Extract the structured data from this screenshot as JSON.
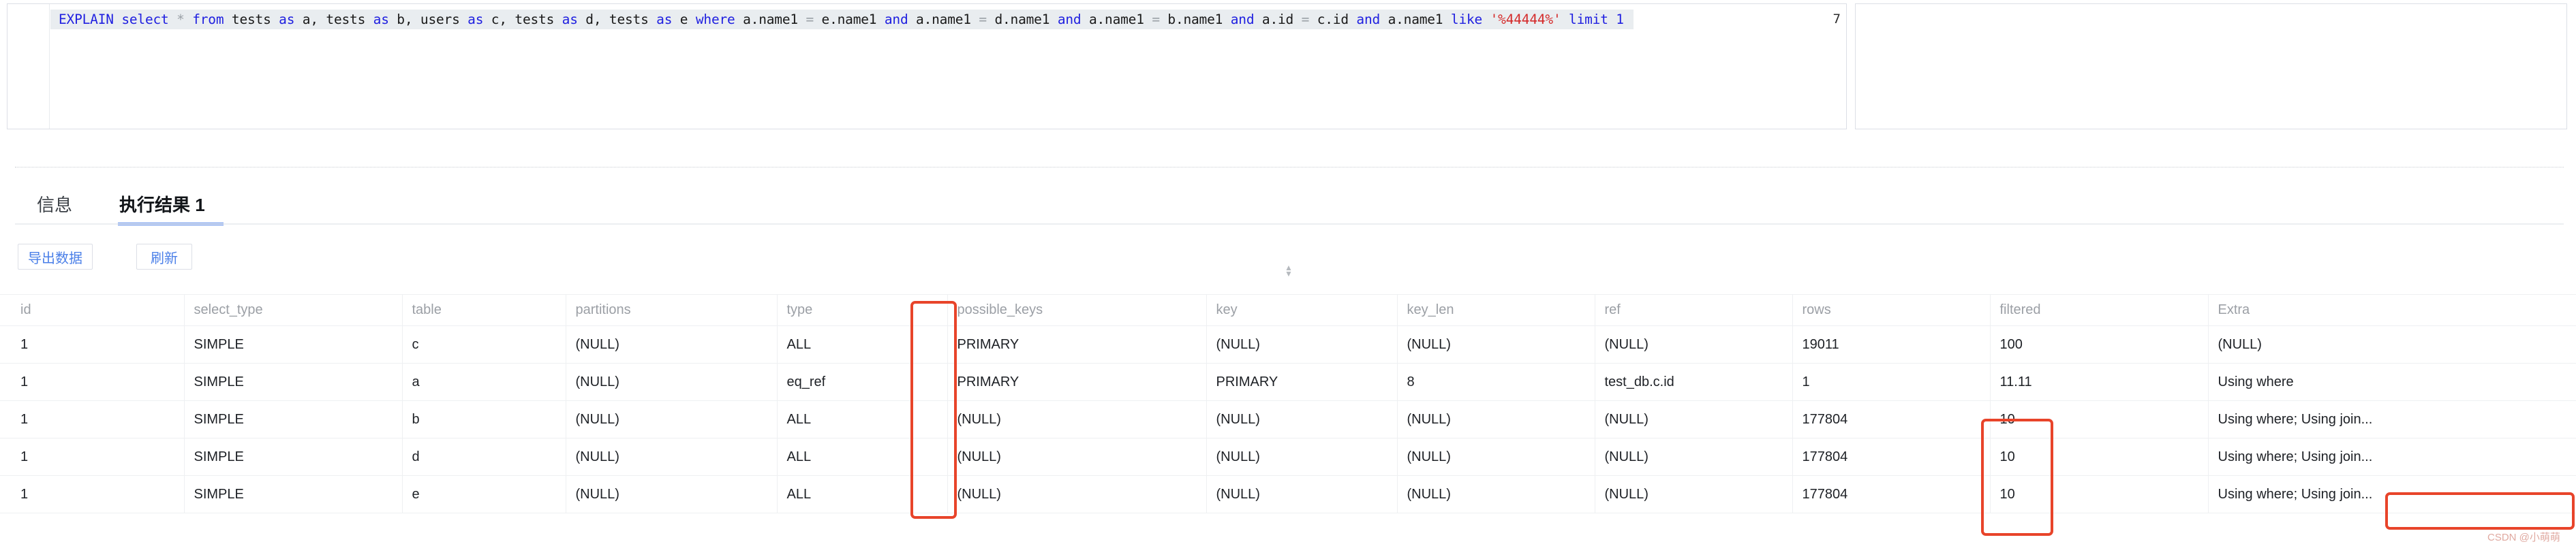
{
  "editor": {
    "line_number": "7",
    "sql_tokens": [
      {
        "t": "EXPLAIN",
        "c": "kw"
      },
      {
        "t": " ",
        "c": "plain"
      },
      {
        "t": "select",
        "c": "kw"
      },
      {
        "t": " ",
        "c": "plain"
      },
      {
        "t": "*",
        "c": "op-star"
      },
      {
        "t": " ",
        "c": "plain"
      },
      {
        "t": "from",
        "c": "kw"
      },
      {
        "t": " tests ",
        "c": "plain"
      },
      {
        "t": "as",
        "c": "kw"
      },
      {
        "t": " a, tests ",
        "c": "plain"
      },
      {
        "t": "as",
        "c": "kw"
      },
      {
        "t": " b, users ",
        "c": "plain"
      },
      {
        "t": "as",
        "c": "kw"
      },
      {
        "t": " c, tests ",
        "c": "plain"
      },
      {
        "t": "as",
        "c": "kw"
      },
      {
        "t": " d, tests ",
        "c": "plain"
      },
      {
        "t": "as",
        "c": "kw"
      },
      {
        "t": " e  ",
        "c": "plain"
      },
      {
        "t": "where",
        "c": "kw"
      },
      {
        "t": " a.name1 ",
        "c": "plain"
      },
      {
        "t": "=",
        "c": "eq"
      },
      {
        "t": " e.name1 ",
        "c": "plain"
      },
      {
        "t": "and",
        "c": "kw"
      },
      {
        "t": "  a.name1 ",
        "c": "plain"
      },
      {
        "t": "=",
        "c": "eq"
      },
      {
        "t": " d.name1 ",
        "c": "plain"
      },
      {
        "t": "and",
        "c": "kw"
      },
      {
        "t": "  a.name1 ",
        "c": "plain"
      },
      {
        "t": "=",
        "c": "eq"
      },
      {
        "t": " b.name1 ",
        "c": "plain"
      },
      {
        "t": "and",
        "c": "kw"
      },
      {
        "t": " a.id ",
        "c": "plain"
      },
      {
        "t": "=",
        "c": "eq"
      },
      {
        "t": " c.id ",
        "c": "plain"
      },
      {
        "t": "and",
        "c": "kw"
      },
      {
        "t": " a.name1 ",
        "c": "plain"
      },
      {
        "t": "like",
        "c": "kw"
      },
      {
        "t": " ",
        "c": "plain"
      },
      {
        "t": "'%44444%'",
        "c": "str"
      },
      {
        "t": " ",
        "c": "plain"
      },
      {
        "t": "limit",
        "c": "kw"
      },
      {
        "t": " ",
        "c": "plain"
      },
      {
        "t": "1",
        "c": "kw"
      }
    ],
    "sql_plain": "EXPLAIN select * from tests as a, tests as b, users as c, tests as d, tests as e  where a.name1 = e.name1 and  a.name1 = d.name1 and  a.name1 = b.name1 and a.id = c.id and a.name1 like '%44444%' limit 1",
    "splitter_glyph": "⌃⌄"
  },
  "tabs": [
    {
      "label": "信息",
      "active": false
    },
    {
      "label": "执行结果 1",
      "active": true
    }
  ],
  "toolbar": {
    "export_label": "导出数据",
    "refresh_label": "刷新"
  },
  "table": {
    "columns": [
      "id",
      "select_type",
      "table",
      "partitions",
      "type",
      "possible_keys",
      "key",
      "key_len",
      "ref",
      "rows",
      "filtered",
      "Extra"
    ],
    "rows": [
      {
        "id": "1",
        "select_type": "SIMPLE",
        "table": "c",
        "partitions": "(NULL)",
        "type": "ALL",
        "possible_keys": "PRIMARY",
        "key": "(NULL)",
        "key_len": "(NULL)",
        "ref": "(NULL)",
        "rows": "19011",
        "filtered": "100",
        "Extra": "(NULL)"
      },
      {
        "id": "1",
        "select_type": "SIMPLE",
        "table": "a",
        "partitions": "(NULL)",
        "type": "eq_ref",
        "possible_keys": "PRIMARY",
        "key": "PRIMARY",
        "key_len": "8",
        "ref": "test_db.c.id",
        "rows": "1",
        "filtered": "11.11",
        "Extra": "Using where"
      },
      {
        "id": "1",
        "select_type": "SIMPLE",
        "table": "b",
        "partitions": "(NULL)",
        "type": "ALL",
        "possible_keys": "(NULL)",
        "key": "(NULL)",
        "key_len": "(NULL)",
        "ref": "(NULL)",
        "rows": "177804",
        "filtered": "10",
        "Extra": "Using where; Using join..."
      },
      {
        "id": "1",
        "select_type": "SIMPLE",
        "table": "d",
        "partitions": "(NULL)",
        "type": "ALL",
        "possible_keys": "(NULL)",
        "key": "(NULL)",
        "key_len": "(NULL)",
        "ref": "(NULL)",
        "rows": "177804",
        "filtered": "10",
        "Extra": "Using where; Using join..."
      },
      {
        "id": "1",
        "select_type": "SIMPLE",
        "table": "e",
        "partitions": "(NULL)",
        "type": "ALL",
        "possible_keys": "(NULL)",
        "key": "(NULL)",
        "key_len": "(NULL)",
        "ref": "(NULL)",
        "rows": "177804",
        "filtered": "10",
        "Extra": "Using where; Using join..."
      }
    ]
  },
  "annotations": {
    "accent_color": "#e8442a",
    "boxes": [
      "type-column",
      "rows-values",
      "extra-last-cell"
    ]
  },
  "watermark": "CSDN @小萌萌",
  "colors": {
    "keyword_blue": "#2020e0",
    "string_red": "#d42a2a",
    "tab_active_blue": "#4a7fe8",
    "button_blue": "#4a7fe8",
    "null_gray": "#a8acb2"
  }
}
